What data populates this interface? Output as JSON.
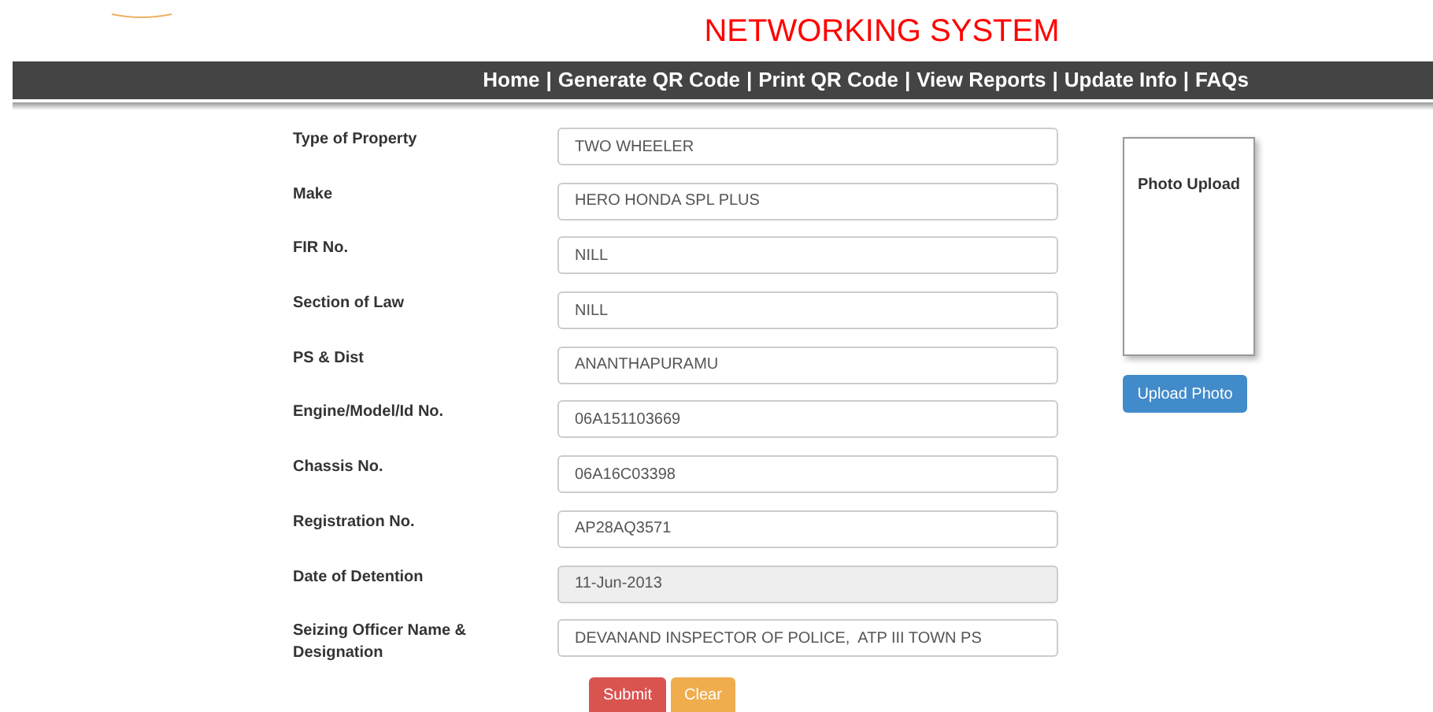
{
  "header": {
    "title": "NETWORKING SYSTEM"
  },
  "nav": [
    {
      "label": "Home",
      "separator": "|"
    },
    {
      "label": "Generate QR Code",
      "separator": "|"
    },
    {
      "label": "Print QR Code",
      "separator": "|"
    },
    {
      "label": "View Reports",
      "separator": "|"
    },
    {
      "label": "Update Info",
      "separator": "|"
    },
    {
      "label": "FAQs"
    }
  ],
  "fields": [
    {
      "label": "Type of Property",
      "value": "TWO WHEELER",
      "disabled": false
    },
    {
      "label": "Make",
      "value": "HERO HONDA SPL PLUS",
      "disabled": false
    },
    {
      "label": "FIR No.",
      "value": "NILL",
      "disabled": false
    },
    {
      "label": "Section of Law",
      "value": "NILL",
      "disabled": false
    },
    {
      "label": "PS & Dist",
      "value": "ANANTHAPURAMU",
      "disabled": false
    },
    {
      "label": "Engine/Model/Id No.",
      "value": "06A151103669",
      "disabled": false
    },
    {
      "label": "Chassis No.",
      "value": "06A16C03398",
      "disabled": false
    },
    {
      "label": "Registration No.",
      "value": "AP28AQ3571",
      "disabled": false
    },
    {
      "label": "Date of Detention",
      "value": "11-Jun-2013",
      "disabled": true
    },
    {
      "label": "Seizing Officer Name & Designation",
      "value": "DEVANAND INSPECTOR OF POLICE,  ATP III TOWN PS",
      "disabled": false
    }
  ],
  "photo": {
    "label": "Photo Upload",
    "button": "Upload Photo"
  },
  "buttons": [
    {
      "label": "Submit",
      "kind": "danger"
    },
    {
      "label": "Clear",
      "kind": "warning"
    }
  ]
}
